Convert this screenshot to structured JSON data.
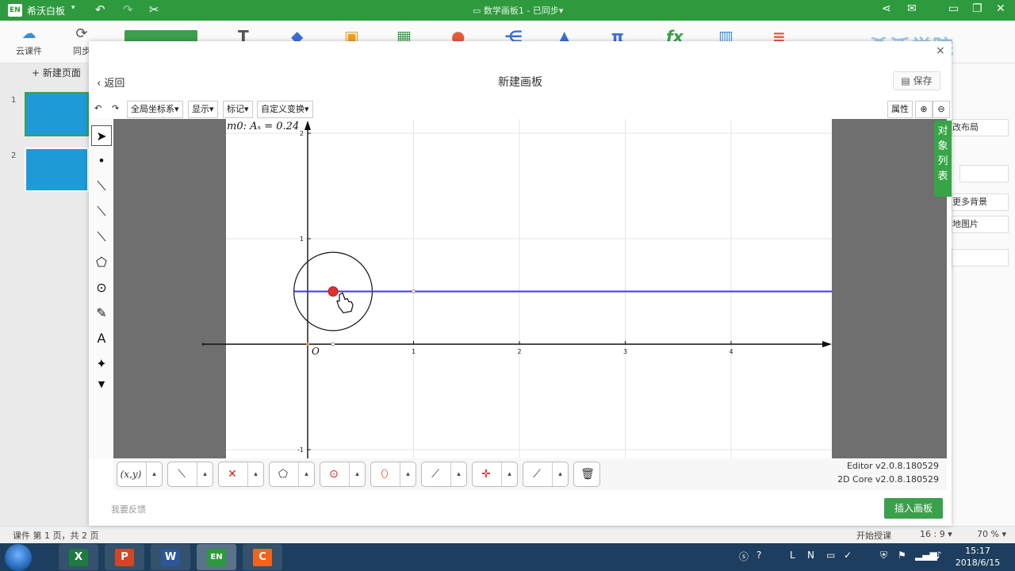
{
  "titlebar": {
    "app_badge": "EN",
    "app_name": "希沃白板",
    "doc_title": "数学画板1 - 已同步",
    "caret": "▾",
    "icons": [
      "undo-icon",
      "redo-icon",
      "scissors-icon",
      "share-icon",
      "mail-icon",
      "restore-icon",
      "maximize-icon",
      "close-icon"
    ]
  },
  "toolbar": {
    "cloud_label": "云课件",
    "sync_label": "同步",
    "brand": "希沃学院"
  },
  "pages": {
    "new_page": "+ 新建页面",
    "numbers": [
      "1",
      "2"
    ]
  },
  "props": {
    "items": [
      "改布局",
      "更多背景",
      "地图片"
    ]
  },
  "status": {
    "page_info": "课件 第 1 页，共 2 页",
    "start_teach": "开始授课",
    "ratio": "16 : 9 ▾",
    "zoom": "70 % ▾"
  },
  "taskbar": {
    "time": "15:17",
    "date": "2018/6/15",
    "apps": [
      "X",
      "P",
      "W",
      "EN",
      "C"
    ]
  },
  "dialog": {
    "back": "返回",
    "title": "新建画板",
    "save": "保存",
    "close": "×",
    "menu": [
      "全局坐标系▾",
      "显示▾",
      "标记▾",
      "自定义变换▾"
    ],
    "attr": "属性",
    "object_list": [
      "对",
      "象",
      "列",
      "表"
    ],
    "readout": "m0: Aₓ = 0.24",
    "origin_label": "O",
    "version_editor": "Editor v2.0.8.180529",
    "version_core": "2D Core v2.0.8.180529",
    "feedback": "我要反馈",
    "insert": "插入画板",
    "coord_tool": "(x,y)",
    "text_tool": "A",
    "palette_more": "▴"
  },
  "chart_data": {
    "type": "scatter",
    "x_ticks": [
      1,
      2,
      3,
      4
    ],
    "y_ticks": [
      -1,
      1,
      2
    ],
    "x_range": [
      -1,
      4.9
    ],
    "y_range": [
      -1.05,
      2.1
    ],
    "point": {
      "name": "A",
      "x": 0.24,
      "y": 0.5
    },
    "circle": {
      "cx": 0.24,
      "cy": 0.5,
      "r": 0.37
    },
    "ray": {
      "from": [
        -0.13,
        0.5
      ],
      "direction": "+x"
    },
    "origin_marker": [
      0.24,
      0
    ],
    "colors": {
      "axis": "#111111",
      "ray": "#3b3bd9",
      "point": "#e03030",
      "grid": "#e6e6e6"
    }
  }
}
